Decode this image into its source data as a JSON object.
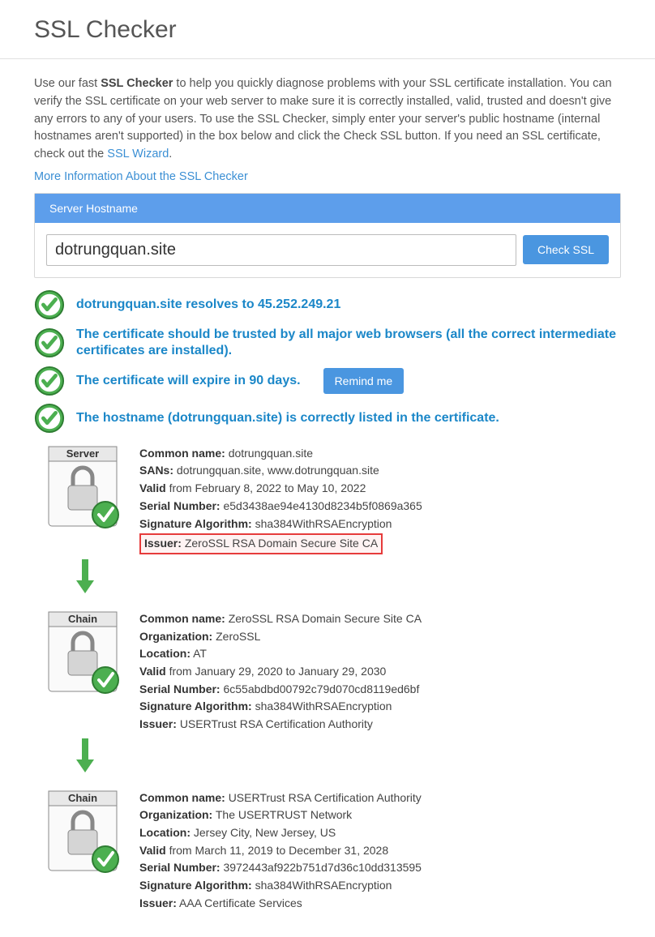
{
  "header": {
    "title": "SSL Checker"
  },
  "intro": {
    "prefix": "Use our fast ",
    "bold": "SSL Checker",
    "rest": " to help you quickly diagnose problems with your SSL certificate installation. You can verify the SSL certificate on your web server to make sure it is correctly installed, valid, trusted and doesn't give any errors to any of your users. To use the SSL Checker, simply enter your server's public hostname (internal hostnames aren't supported) in the box below and click the Check SSL button. If you need an SSL certificate, check out the ",
    "wizard_link": "SSL Wizard",
    "period": "."
  },
  "more_info": "More Information About the SSL Checker",
  "panel": {
    "header": "Server Hostname",
    "hostname_value": "dotrungquan.site",
    "check_button": "Check SSL"
  },
  "checks": [
    {
      "text": "dotrungquan.site resolves to 45.252.249.21"
    },
    {
      "text": "The certificate should be trusted by all major web browsers (all the correct intermediate certificates are installed)."
    },
    {
      "text": "The certificate will expire in 90 days.",
      "remind": "Remind me"
    },
    {
      "text": "The hostname (dotrungquan.site) is correctly listed in the certificate."
    }
  ],
  "certs": [
    {
      "tag": "Server",
      "common_name_label": "Common name:",
      "common_name": "dotrungquan.site",
      "sans_label": "SANs:",
      "sans": "dotrungquan.site, www.dotrungquan.site",
      "valid_label": "Valid",
      "valid": "from February 8, 2022 to May 10, 2022",
      "serial_label": "Serial Number:",
      "serial": "e5d3438ae94e4130d8234b5f0869a365",
      "sigalg_label": "Signature Algorithm:",
      "sigalg": "sha384WithRSAEncryption",
      "issuer_label": "Issuer:",
      "issuer": "ZeroSSL RSA Domain Secure Site CA",
      "highlight_issuer": true
    },
    {
      "tag": "Chain",
      "common_name_label": "Common name:",
      "common_name": "ZeroSSL RSA Domain Secure Site CA",
      "org_label": "Organization:",
      "org": "ZeroSSL",
      "location_label": "Location:",
      "location": "AT",
      "valid_label": "Valid",
      "valid": "from January 29, 2020 to January 29, 2030",
      "serial_label": "Serial Number:",
      "serial": "6c55abdbd00792c79d070cd8119ed6bf",
      "sigalg_label": "Signature Algorithm:",
      "sigalg": "sha384WithRSAEncryption",
      "issuer_label": "Issuer:",
      "issuer": "USERTrust RSA Certification Authority"
    },
    {
      "tag": "Chain",
      "common_name_label": "Common name:",
      "common_name": "USERTrust RSA Certification Authority",
      "org_label": "Organization:",
      "org": "The USERTRUST Network",
      "location_label": "Location:",
      "location": "Jersey City, New Jersey, US",
      "valid_label": "Valid",
      "valid": "from March 11, 2019 to December 31, 2028",
      "serial_label": "Serial Number:",
      "serial": "3972443af922b751d7d36c10dd313595",
      "sigalg_label": "Signature Algorithm:",
      "sigalg": "sha384WithRSAEncryption",
      "issuer_label": "Issuer:",
      "issuer": "AAA Certificate Services"
    }
  ]
}
